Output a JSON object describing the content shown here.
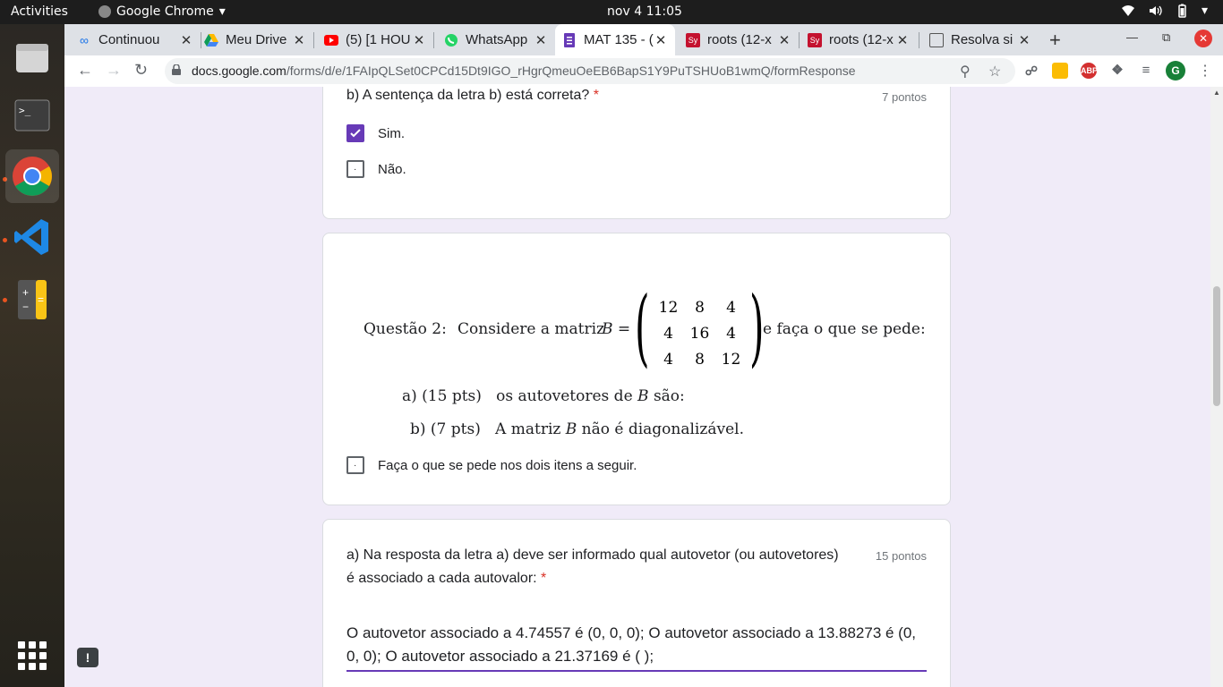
{
  "topbar": {
    "activities": "Activities",
    "app_name": "Google Chrome",
    "clock": "nov 4  11:05"
  },
  "browser": {
    "tabs": [
      {
        "title": "Continuou",
        "favicon_color": "#1a73e8"
      },
      {
        "title": "Meu Drive",
        "favicon_color": "#0f9d58"
      },
      {
        "title": "(5) [1 HOU",
        "favicon_color": "#ff0000"
      },
      {
        "title": "WhatsApp",
        "favicon_color": "#25d366"
      },
      {
        "title": "MAT 135 - (",
        "favicon_color": "#673ab7"
      },
      {
        "title": "roots (12-x",
        "favicon_color": "#c4122f"
      },
      {
        "title": "roots (12-x",
        "favicon_color": "#c4122f"
      },
      {
        "title": "Resolva si",
        "favicon_color": "#555555"
      }
    ],
    "active_tab_index": 4,
    "url_domain": "docs.google.com",
    "url_path": "/forms/d/e/1FAIpQLSet0CPCd15Dt9IGO_rHgrQmeuOeEB6BapS1Y9PuTSHUoB1wmQ/formResponse",
    "profile_initial": "G",
    "abp_label": "ABP"
  },
  "form": {
    "q1": {
      "title": "b) A sentença da letra b) está correta?",
      "required": "*",
      "points": "7 pontos",
      "options": [
        {
          "label": "Sim.",
          "checked": true
        },
        {
          "label": "Não.",
          "checked": false
        }
      ]
    },
    "q2": {
      "prefix": "Questão 2:",
      "statement_start": "Considere a matriz",
      "matrix_name": "B =",
      "matrix": [
        [
          "12",
          "8",
          "4"
        ],
        [
          "4",
          "16",
          "4"
        ],
        [
          "4",
          "8",
          "12"
        ]
      ],
      "statement_end": "e faça o que se pede:",
      "item_a": "a) (15 pts)   os autovetores de",
      "item_a_var": "B",
      "item_a_end": "são:",
      "item_b": "b) (7 pts)   A matriz",
      "item_b_var": "B",
      "item_b_end": "não é diagonalizável.",
      "option": "Faça o que se pede nos dois itens a seguir."
    },
    "q3": {
      "title": "a) Na resposta da letra a) deve ser informado qual autovetor (ou autovetores) é associado a cada autovalor:",
      "required": "*",
      "points": "15 pontos",
      "answer": "O autovetor associado a 4.74557 é (0, 0, 0); O autovetor associado a 13.88273 é (0, 0, 0); O autovetor associado a 21.37169 é ( );"
    }
  },
  "colors": {
    "accent": "#673ab7",
    "page_bg": "#f0ebf8",
    "required": "#d93025"
  }
}
